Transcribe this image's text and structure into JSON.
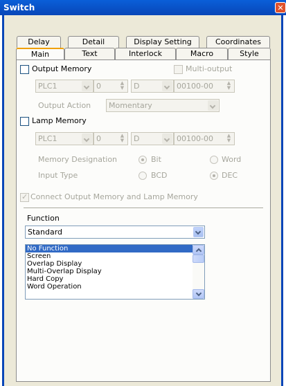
{
  "window": {
    "title": "Switch",
    "close_icon": "close-icon"
  },
  "tabs_row1": [
    "Delay",
    "Detail",
    "Display Setting",
    "Coordinates"
  ],
  "tabs_row2": [
    "Main",
    "Text",
    "Interlock",
    "Macro",
    "Style"
  ],
  "active_tab": "Main",
  "output_memory": {
    "label": "Output Memory",
    "checked": false,
    "multi_output_label": "Multi-output",
    "device": "PLC1",
    "station": "0",
    "address_type": "D",
    "address": "00100-00"
  },
  "output_action": {
    "label": "Output Action",
    "value": "Momentary"
  },
  "lamp_memory": {
    "label": "Lamp Memory",
    "checked": false,
    "device": "PLC1",
    "station": "0",
    "address_type": "D",
    "address": "00100-00"
  },
  "memory_designation": {
    "label": "Memory Designation",
    "options": [
      "Bit",
      "Word"
    ],
    "selected": "Bit"
  },
  "input_type": {
    "label": "Input Type",
    "options": [
      "BCD",
      "DEC"
    ],
    "selected": "DEC"
  },
  "connect_memory": {
    "label": "Connect Output Memory and Lamp Memory",
    "checked": true
  },
  "function": {
    "label": "Function",
    "selected_value": "Standard",
    "list_items": [
      "No Function",
      "Screen",
      "Overlap Display",
      "Multi-Overlap Display",
      "Hard Copy",
      "Word Operation"
    ],
    "selected_item": "No Function"
  },
  "colors": {
    "titlebar": "#0846b8",
    "selection": "#316ac5",
    "active_tab_accent": "#f0a000",
    "window_bg": "#ece9d8"
  }
}
